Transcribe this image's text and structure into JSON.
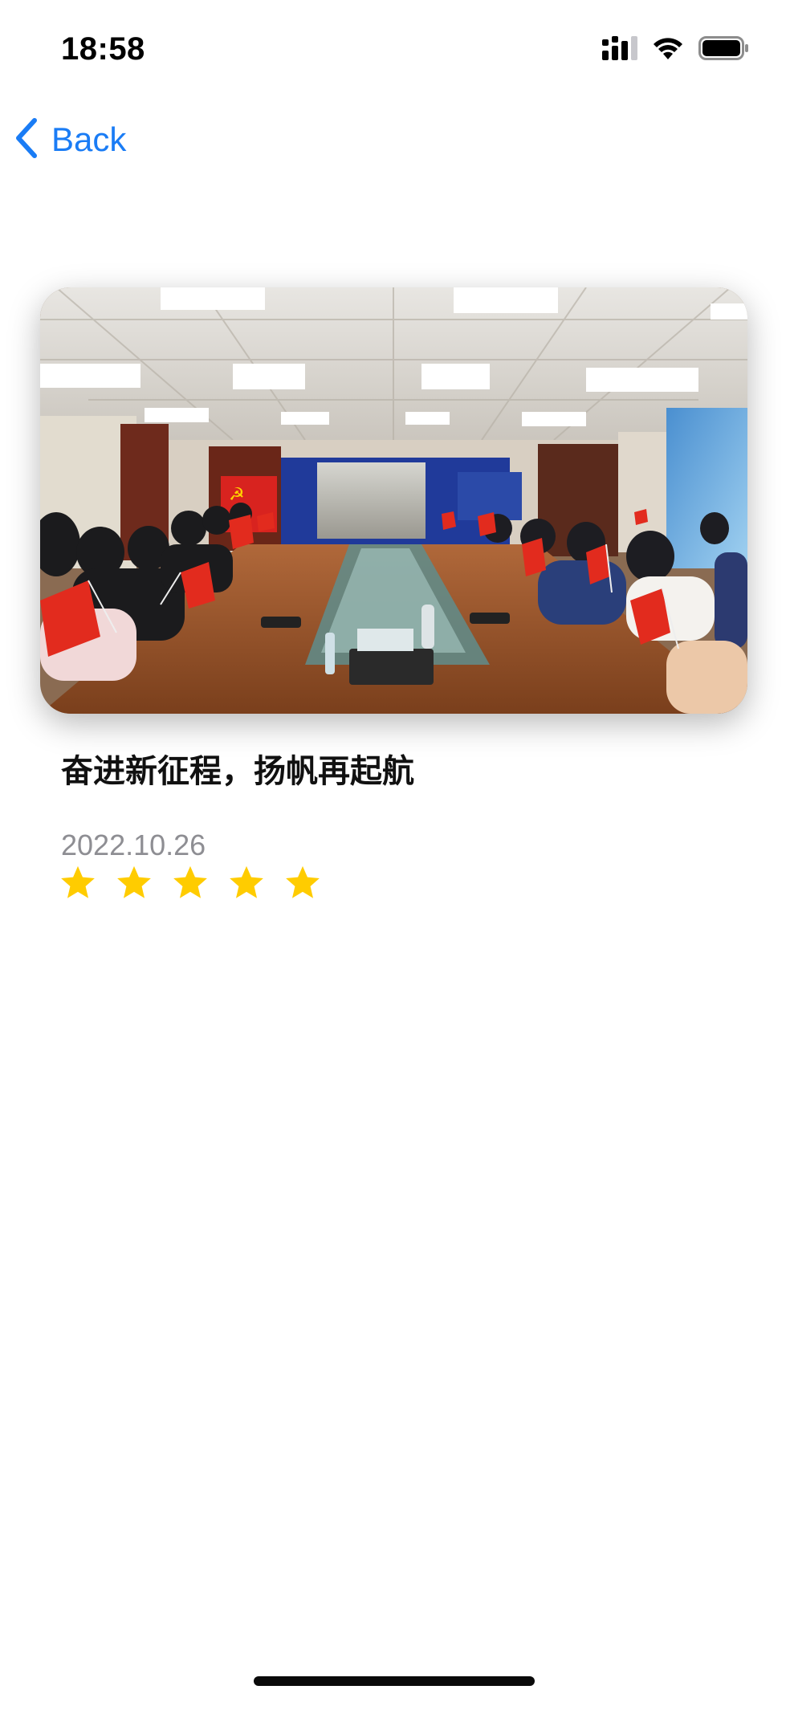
{
  "status_bar": {
    "time": "18:58",
    "icons": [
      "cellular-signal-icon",
      "wifi-icon",
      "battery-icon"
    ]
  },
  "nav": {
    "back_label": "Back",
    "back_icon": "chevron-left-icon",
    "accent_color": "#1a7cf5"
  },
  "article": {
    "image_description_icon": "photo",
    "title": "奋进新征程，扬帆再起航",
    "date": "2022.10.26",
    "rating": 5,
    "rating_max": 5,
    "star_color": "#ffcc00"
  }
}
